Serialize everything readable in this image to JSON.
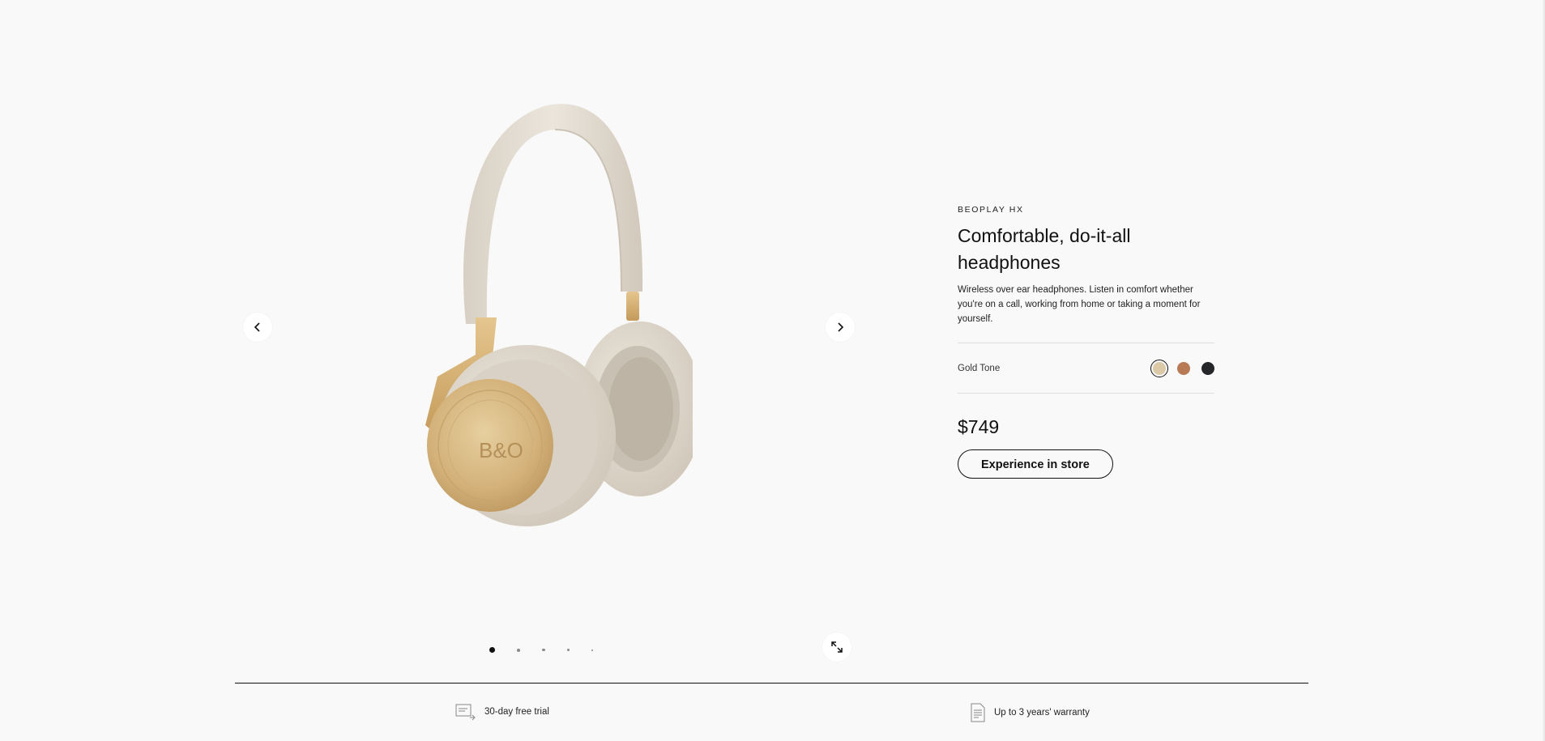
{
  "gallery": {
    "prev_icon": "chevron-left-icon",
    "next_icon": "chevron-right-icon",
    "expand_icon": "expand-icon",
    "slide_count": 5,
    "active_slide": 1
  },
  "product": {
    "eyebrow": "BEOPLAY HX",
    "title": "Comfortable, do-it-all headphones",
    "description": "Wireless over ear headphones. Listen in comfort whether you're on a call, working from home or taking a moment for yourself.",
    "variant_label": "Gold Tone",
    "swatches": [
      {
        "color": "#dcc9a8",
        "selected": true
      },
      {
        "color": "#b87a55",
        "selected": false
      },
      {
        "color": "#24262a",
        "selected": false
      }
    ],
    "price": "$749",
    "cta_label": "Experience in store"
  },
  "benefits": {
    "trial_label": "30-day free trial",
    "trial_icon": "truck-return-icon",
    "warranty_label": "Up to 3 years' warranty",
    "warranty_icon": "document-icon"
  }
}
